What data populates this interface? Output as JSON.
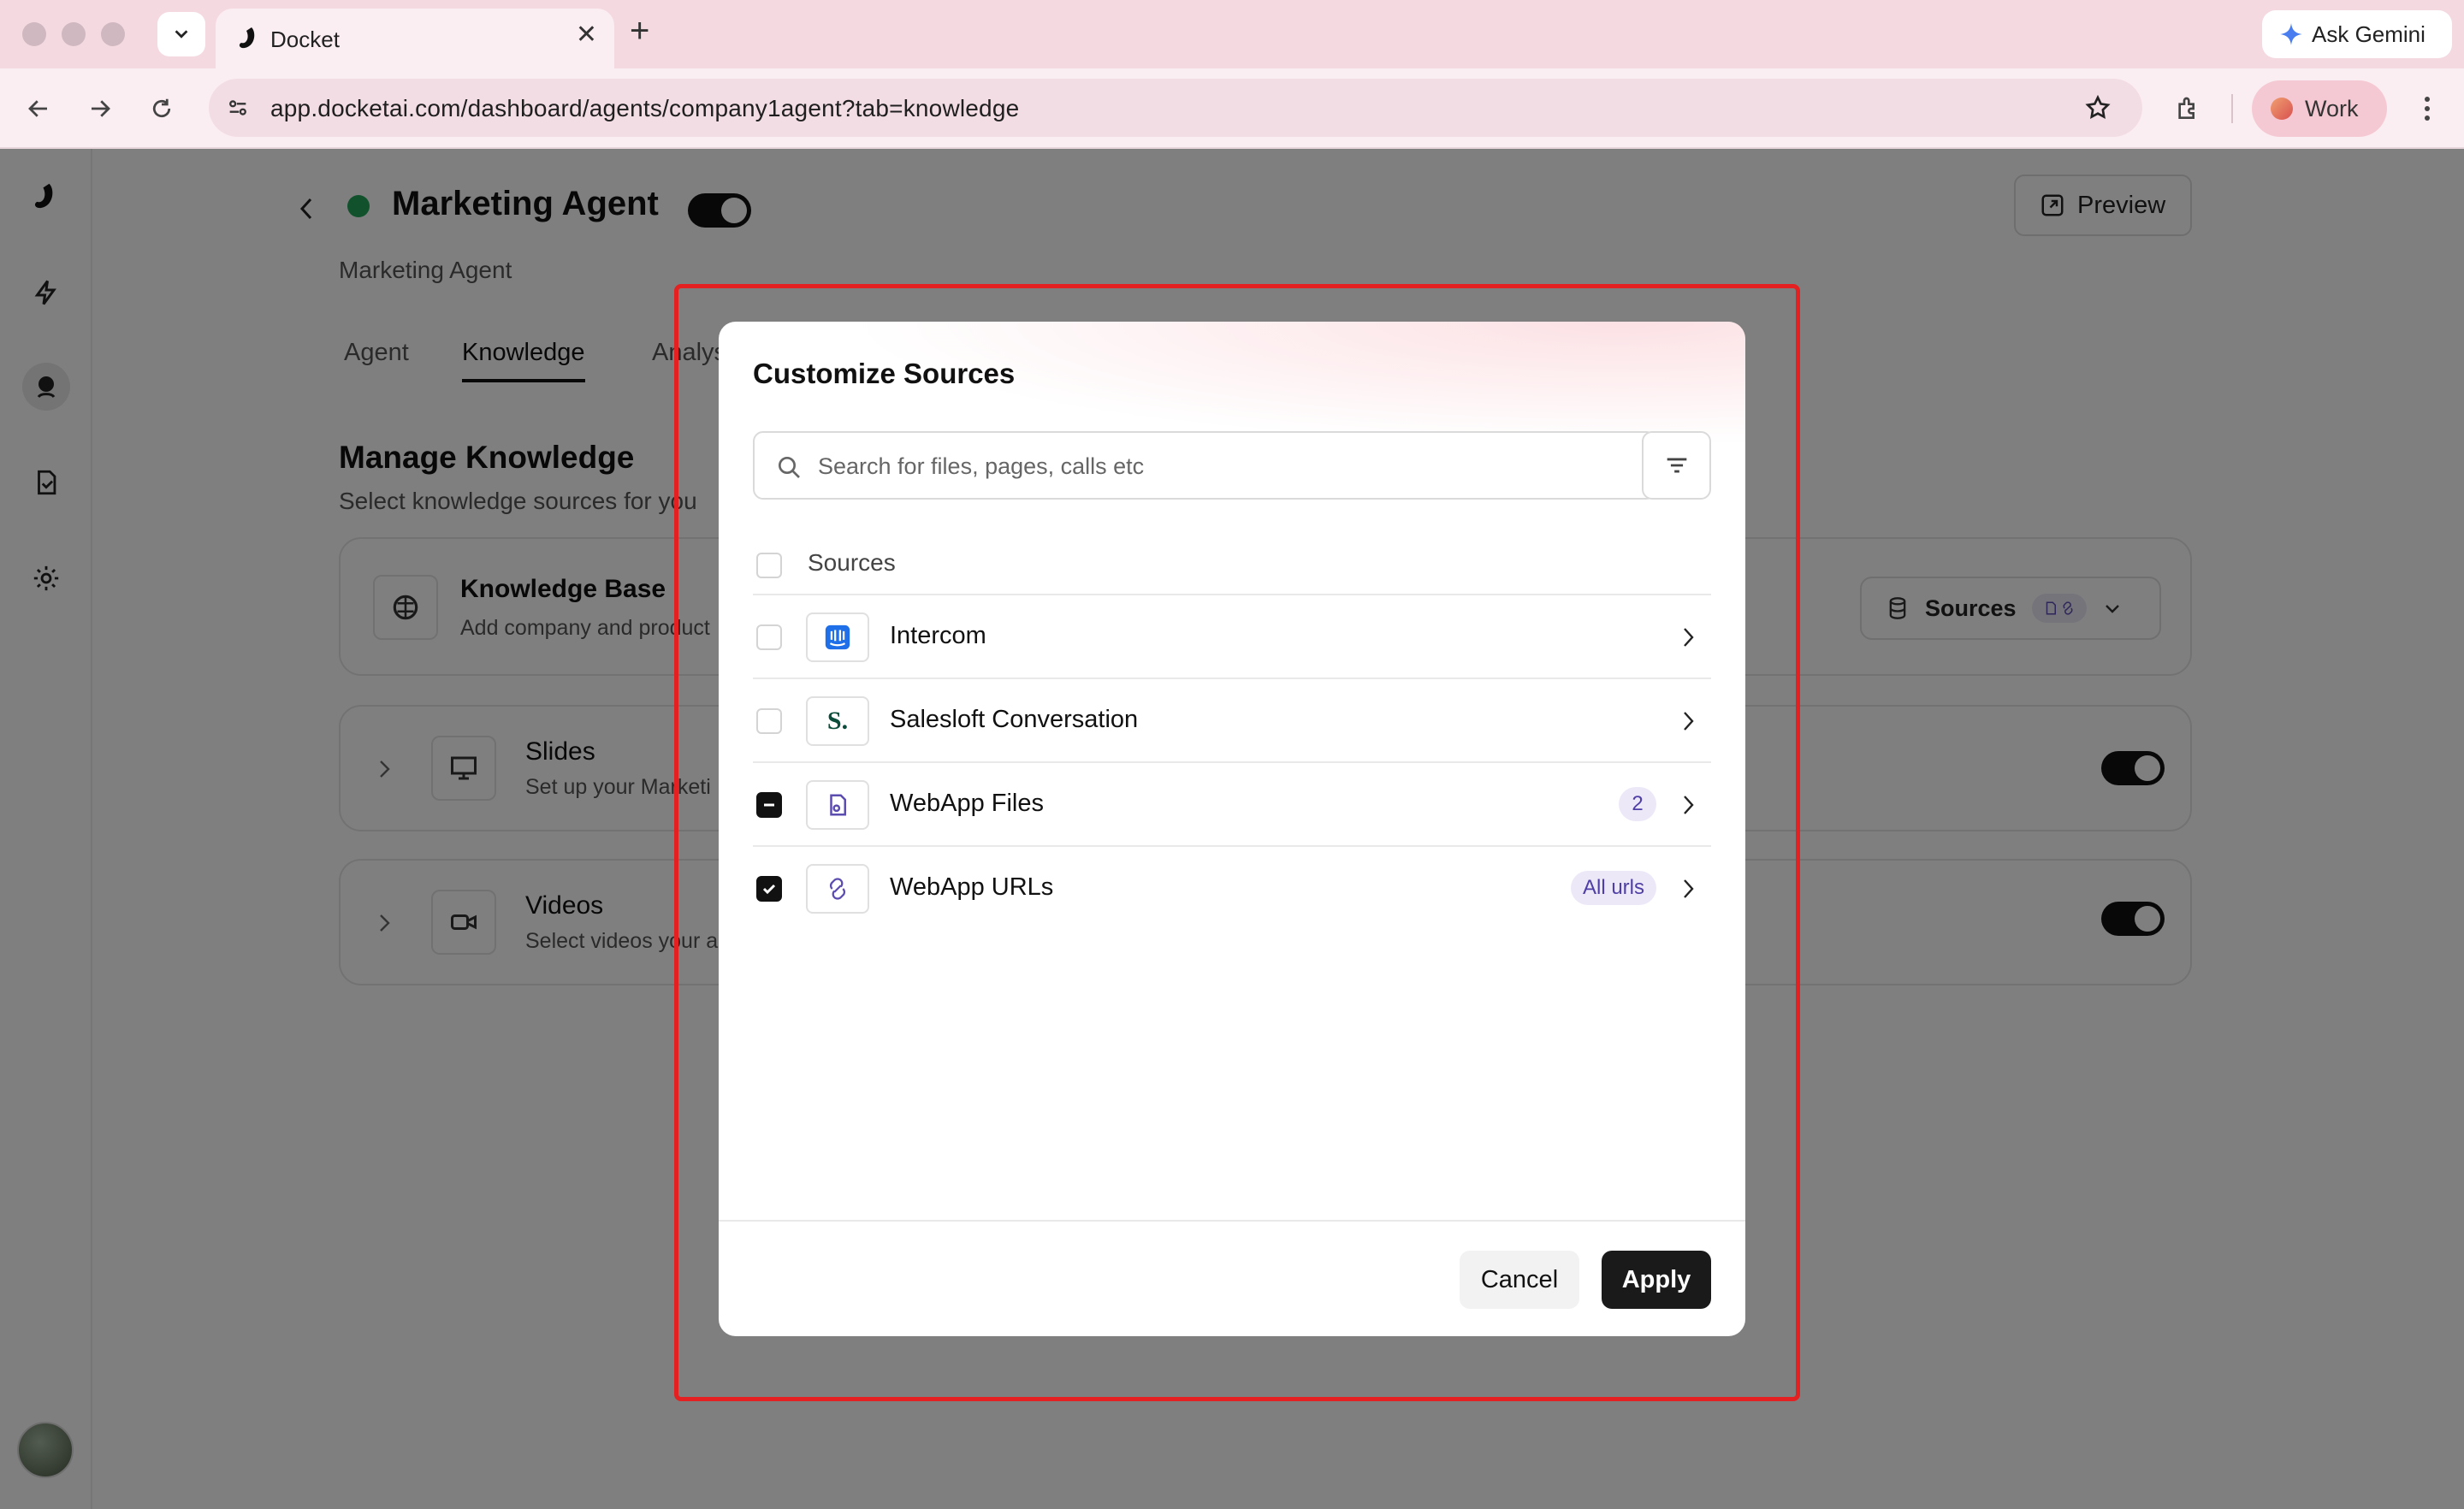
{
  "browser": {
    "tab_title": "Docket",
    "url": "app.docketai.com/dashboard/agents/company1agent?tab=knowledge",
    "gemini_label": "Ask Gemini",
    "profile_label": "Work"
  },
  "agent": {
    "title": "Marketing Agent",
    "subtitle": "Marketing Agent",
    "preview_label": "Preview",
    "tabs": [
      {
        "label": "Agent"
      },
      {
        "label": "Knowledge"
      },
      {
        "label": "Analys"
      }
    ]
  },
  "knowledge": {
    "title": "Manage Knowledge",
    "subtitle": "Select knowledge sources for you",
    "cards": [
      {
        "title": "Knowledge Base",
        "subtitle": "Add company and product",
        "sources_label": "Sources"
      },
      {
        "title": "Slides",
        "subtitle": "Set up your Marketi"
      },
      {
        "title": "Videos",
        "subtitle": "Select videos your a"
      }
    ]
  },
  "modal": {
    "title": "Customize Sources",
    "search_placeholder": "Search for files, pages, calls etc",
    "header_label": "Sources",
    "sources": [
      {
        "name": "Intercom",
        "state": "unchecked"
      },
      {
        "name": "Salesloft Conversation",
        "state": "unchecked",
        "logo_text": "S."
      },
      {
        "name": "WebApp Files",
        "state": "partial",
        "badge": "2"
      },
      {
        "name": "WebApp URLs",
        "state": "checked",
        "badge": "All urls"
      }
    ],
    "cancel_label": "Cancel",
    "apply_label": "Apply"
  },
  "colors": {
    "status_green": "#22a55a",
    "highlight_red": "#e52020",
    "badge_purple": "#4f3ea6",
    "badge_bg": "#ece8f8"
  }
}
